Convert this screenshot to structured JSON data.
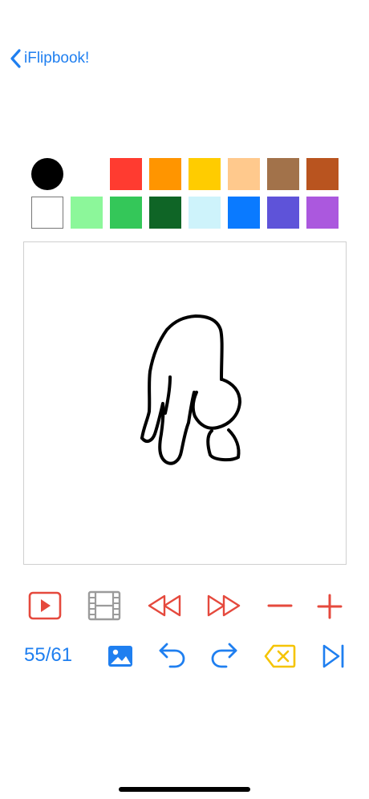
{
  "nav": {
    "back_label": "iFlipbook!",
    "back_icon": "chevron-left-icon",
    "accent": "#1f7ff0"
  },
  "palette": {
    "current_brush_color": "#000000",
    "row1_colors": [
      "#ff3b30",
      "#ff9500",
      "#ffcc00",
      "#ffc98d",
      "#a2724a",
      "#b9541f"
    ],
    "row2_colors": [
      "#ffffff",
      "#8cf79a",
      "#34c759",
      "#0f6526",
      "#cef3fb",
      "#0a7aff",
      "#5e53d9",
      "#ab58de"
    ]
  },
  "canvas": {
    "background": "#ffffff",
    "stroke_color": "#000000"
  },
  "toolbar_top": [
    {
      "name": "play-icon",
      "color": "#e5493d"
    },
    {
      "name": "filmstrip-icon",
      "color": "#9b9b9b"
    },
    {
      "name": "rewind-icon",
      "color": "#e5493d"
    },
    {
      "name": "fast-forward-icon",
      "color": "#e5493d"
    },
    {
      "name": "minus-icon",
      "color": "#e5493d"
    },
    {
      "name": "plus-icon",
      "color": "#e5493d"
    }
  ],
  "toolbar_bottom": {
    "frame_counter": "55/61",
    "icons": [
      {
        "name": "image-icon",
        "color": "#1f7ff0"
      },
      {
        "name": "undo-icon",
        "color": "#1f7ff0"
      },
      {
        "name": "redo-icon",
        "color": "#1f7ff0"
      },
      {
        "name": "delete-icon",
        "color": "#f5c400"
      },
      {
        "name": "skip-to-end-icon",
        "color": "#1f7ff0"
      }
    ]
  }
}
